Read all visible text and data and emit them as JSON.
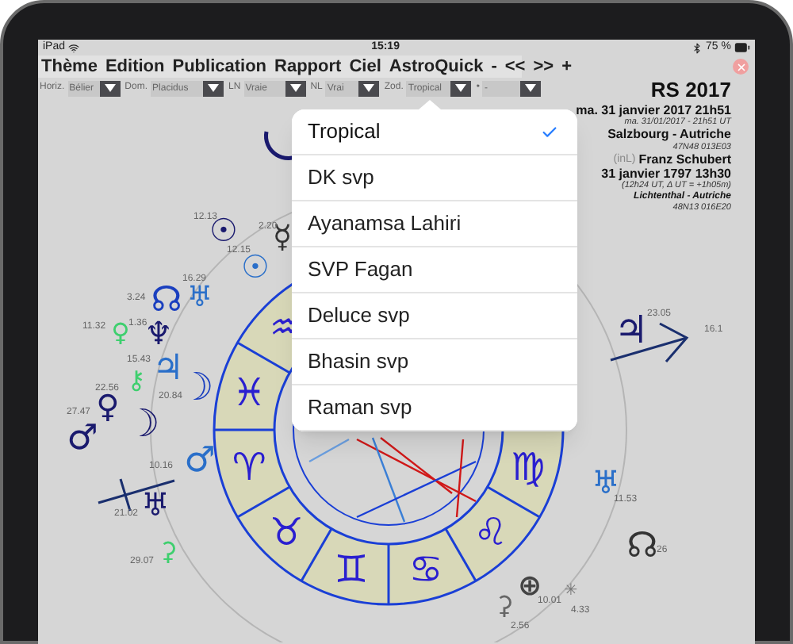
{
  "status_bar": {
    "device": "iPad",
    "time": "15:19",
    "battery": "75 %"
  },
  "menu": [
    "Thème",
    "Edition",
    "Publication",
    "Rapport",
    "Ciel",
    "AstroQuick",
    "-",
    "<<",
    ">>",
    "+"
  ],
  "toolbar": [
    {
      "label": "Horiz.",
      "value": "Bélier"
    },
    {
      "label": "Dom.",
      "value": "Placidus"
    },
    {
      "label": "LN",
      "value": "Vraie"
    },
    {
      "label": "NL",
      "value": "Vrai"
    },
    {
      "label": "Zod.",
      "value": "Tropical"
    },
    {
      "label": "•",
      "value": "-"
    }
  ],
  "info": {
    "title": "RS 2017",
    "date": "ma. 31 janvier 2017 21h51",
    "ut": "ma. 31/01/2017 - 21h51 UT",
    "place": "Salzbourg - Autriche",
    "coords": "47N48 013E03",
    "tag": "(inL)",
    "name": "Franz Schubert",
    "birth": "31 janvier 1797 13h30",
    "birth_ut": "(12h24 UT, Δ UT = +1h05m)",
    "birth_place": "Lichtenthal - Autriche",
    "birth_coords": "48N13 016E20"
  },
  "zodiac_popup": {
    "options": [
      {
        "label": "Tropical",
        "selected": true
      },
      {
        "label": "DK svp",
        "selected": false
      },
      {
        "label": "Ayanamsa Lahiri",
        "selected": false
      },
      {
        "label": "SVP Fagan",
        "selected": false
      },
      {
        "label": "Deluce svp",
        "selected": false
      },
      {
        "label": "Bhasin svp",
        "selected": false
      },
      {
        "label": "Raman svp",
        "selected": false
      }
    ]
  },
  "chart": {
    "signs": [
      "♒",
      "♓",
      "♈",
      "♉",
      "♊",
      "♋",
      "♌",
      "♍"
    ],
    "planets": [
      {
        "glyph": "☉",
        "color": "#1a1a6e"
      },
      {
        "glyph": "☿",
        "color": "#333333"
      },
      {
        "glyph": "☉",
        "color": "#2a6fc9"
      },
      {
        "glyph": "☊",
        "color": "#1a3fbf"
      },
      {
        "glyph": "♅",
        "color": "#2a6fc9"
      },
      {
        "glyph": "♀",
        "color": "#3ecf6e"
      },
      {
        "glyph": "♆",
        "color": "#1a1a6e"
      },
      {
        "glyph": "♃",
        "color": "#2a6fc9"
      },
      {
        "glyph": "☽",
        "color": "#1a3fbf"
      },
      {
        "glyph": "⚷",
        "color": "#3ecf6e"
      },
      {
        "glyph": "♀",
        "color": "#1a1a6e"
      },
      {
        "glyph": "♂",
        "color": "#1a1a6e"
      },
      {
        "glyph": "☽",
        "color": "#1a1a6e"
      },
      {
        "glyph": "♂",
        "color": "#2a6fc9"
      },
      {
        "glyph": "♅",
        "color": "#1a1a6e"
      },
      {
        "glyph": "⚳",
        "color": "#3ecf6e"
      },
      {
        "glyph": "♃",
        "color": "#1a1a6e"
      },
      {
        "glyph": "♅",
        "color": "#2a6fc9"
      },
      {
        "glyph": "☊",
        "color": "#333333"
      },
      {
        "glyph": "⊕",
        "color": "#444444"
      },
      {
        "glyph": "⚳",
        "color": "#666666"
      },
      {
        "glyph": "✳",
        "color": "#777777"
      }
    ],
    "degree_labels": [
      "12.13",
      "2.20",
      "12.15",
      "16.29",
      "3.24",
      "11.32",
      "1.36",
      "15.43",
      "20.84",
      "22.56",
      "27.47",
      "10.16",
      "21.02",
      "29.07",
      "23.05",
      "16.1",
      "11.53",
      "26",
      "10.01",
      "4.33",
      "2.56"
    ]
  }
}
